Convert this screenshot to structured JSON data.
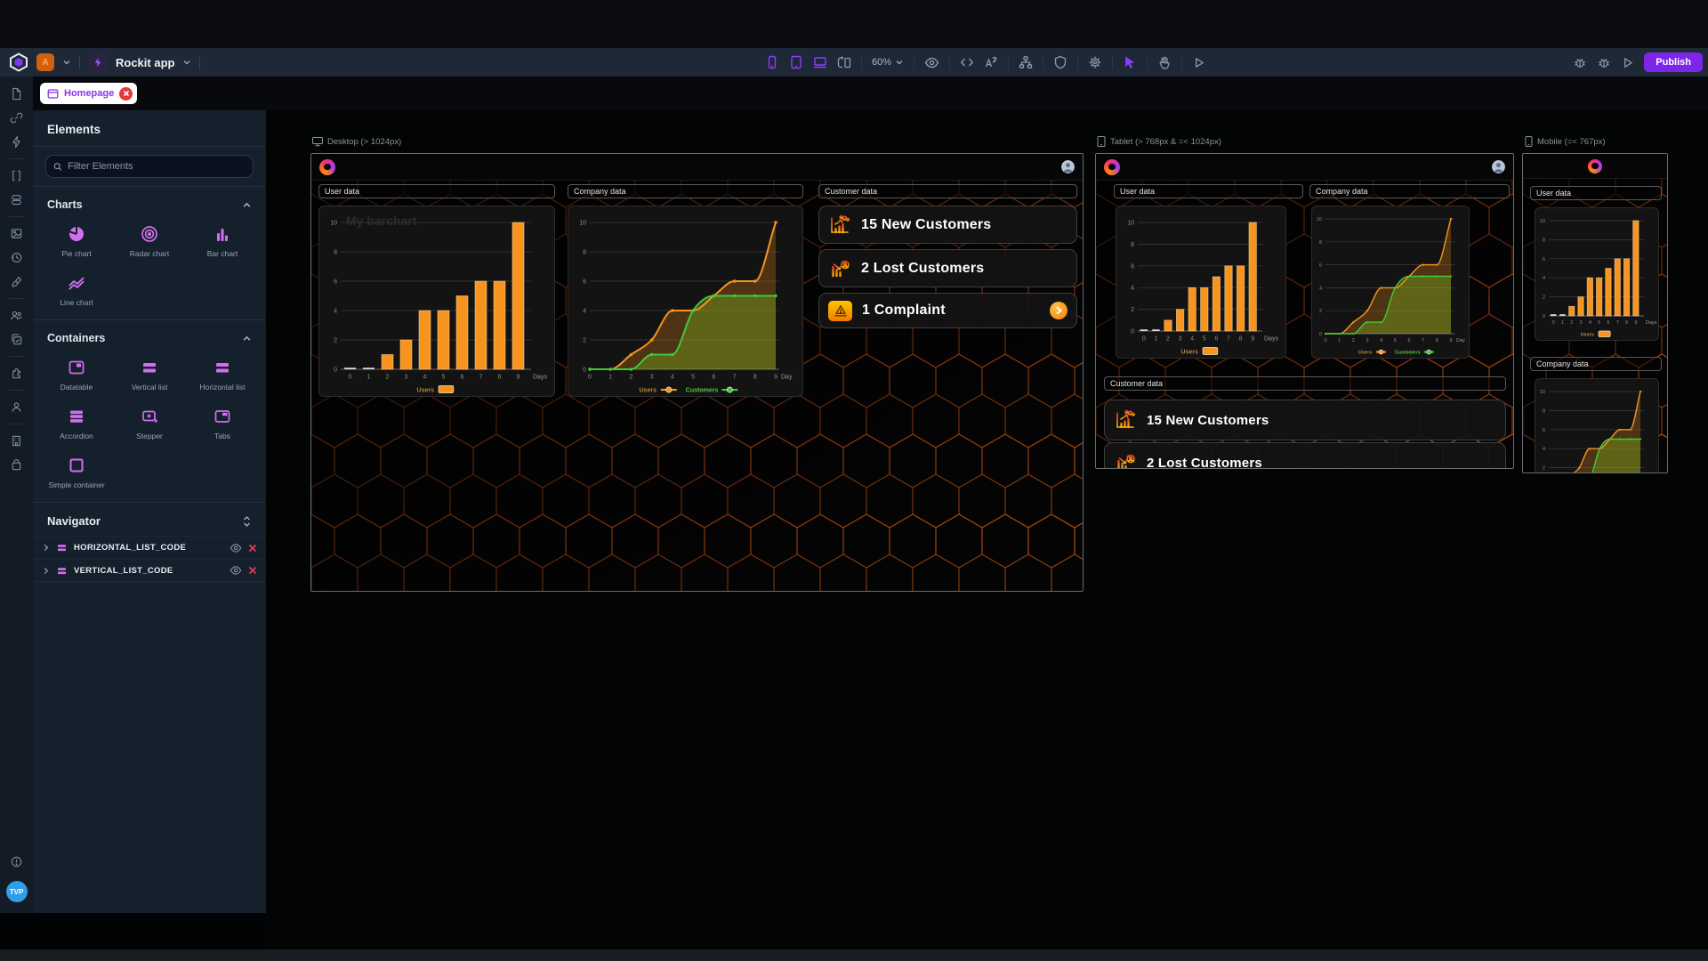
{
  "topbar": {
    "workspace_initial": "A",
    "app_name": "Rockit app",
    "zoom_level": "60%",
    "publish_label": "Publish"
  },
  "tab": {
    "label": "Homepage"
  },
  "elements_panel": {
    "title": "Elements",
    "filter_placeholder": "Filter Elements",
    "charts_section": {
      "label": "Charts",
      "items": [
        {
          "label": "Pie chart"
        },
        {
          "label": "Radar chart"
        },
        {
          "label": "Bar chart"
        },
        {
          "label": "Line chart"
        }
      ]
    },
    "containers_section": {
      "label": "Containers",
      "items": [
        {
          "label": "Datatable"
        },
        {
          "label": "Vertical list"
        },
        {
          "label": "Horizontal list"
        },
        {
          "label": "Accordion"
        },
        {
          "label": "Stepper"
        },
        {
          "label": "Tabs"
        },
        {
          "label": "Simple container"
        }
      ]
    }
  },
  "navigator": {
    "title": "Navigator",
    "items": [
      {
        "label": "HORIZONTAL_LIST_CODE"
      },
      {
        "label": "VERTICAL_LIST_CODE"
      }
    ]
  },
  "rail": {
    "avatar_initials": "TVP"
  },
  "previews": {
    "desktop": {
      "label": "Desktop (> 1024px)"
    },
    "tablet": {
      "label": "Tablet (> 768px & =< 1024px)"
    },
    "mobile": {
      "label": "Mobile (=< 767px)"
    },
    "panels": {
      "user": "User data",
      "company": "Company data",
      "customer": "Customer data"
    },
    "stats": [
      {
        "text": "15 New Customers"
      },
      {
        "text": "2 Lost Customers"
      },
      {
        "text": "1 Complaint"
      }
    ]
  },
  "colors": {
    "accent_purple": "#8b3dff",
    "publish_purple": "#7d26ea",
    "element_pink": "#d46ef0",
    "chart_orange": "#f7941d",
    "chart_green": "#3ecb38",
    "hex_pattern_orange": "#d9570f",
    "workspace_orange": "#d2610e",
    "close_red": "#e5383b",
    "avatar_blue": "#2e9fe6"
  },
  "chart_data": [
    {
      "id": "users_bar",
      "type": "bar",
      "title": "My barchart",
      "categories": [
        "0",
        "1",
        "2",
        "3",
        "4",
        "5",
        "6",
        "7",
        "8",
        "9"
      ],
      "values": [
        0,
        0,
        1,
        2,
        4,
        4,
        5,
        6,
        6,
        10
      ],
      "xlabel": "Days",
      "legend": [
        "Users"
      ],
      "ylim": [
        0,
        10
      ],
      "yticks": [
        0,
        2,
        4,
        6,
        8,
        10
      ],
      "color": "#f7941d",
      "grid": true,
      "legend_position": "bottom"
    },
    {
      "id": "company_lines",
      "type": "line",
      "x": [
        "0",
        "1",
        "2",
        "3",
        "4",
        "5",
        "6",
        "7",
        "8",
        "9"
      ],
      "series": [
        {
          "name": "Users",
          "values": [
            0,
            0,
            1,
            2,
            4,
            4,
            5,
            6,
            6,
            10
          ],
          "color": "#f7941d",
          "fill": "rgba(216,130,26,0.30)",
          "legend_color": "#c08a36"
        },
        {
          "name": "Customers",
          "values": [
            0,
            0,
            0,
            1,
            1,
            4,
            5,
            5,
            5,
            5
          ],
          "color": "#3ecb38",
          "fill": "rgba(130,190,30,0.35)",
          "legend_color": "#53c93f"
        }
      ],
      "xlabel": "Day",
      "ylim": [
        0,
        10
      ],
      "yticks": [
        0,
        2,
        4,
        6,
        8,
        10
      ],
      "grid": true,
      "legend_position": "bottom"
    }
  ]
}
